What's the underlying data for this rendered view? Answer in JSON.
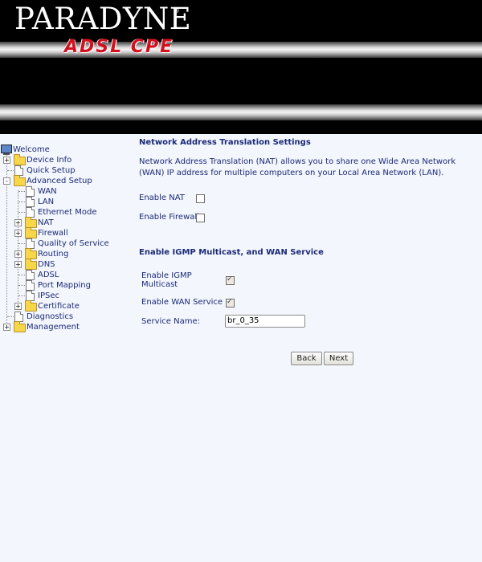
{
  "header": {
    "brand": "PARADYNE",
    "registered": "®",
    "product": "ADSL CPE"
  },
  "sidebar": {
    "items": [
      {
        "label": "Welcome",
        "icon": "monitor-icon"
      },
      {
        "label": "Device Info",
        "icon": "folder-icon",
        "expander": "+"
      },
      {
        "label": "Quick  Setup",
        "icon": "page-icon"
      },
      {
        "label": "Advanced Setup",
        "icon": "folder-open-icon",
        "expander": "-"
      },
      {
        "label": "WAN",
        "icon": "page-icon"
      },
      {
        "label": "LAN",
        "icon": "page-icon"
      },
      {
        "label": "Ethernet Mode",
        "icon": "page-icon"
      },
      {
        "label": "NAT",
        "icon": "folder-icon",
        "expander": "+"
      },
      {
        "label": "Firewall",
        "icon": "folder-icon",
        "expander": "+"
      },
      {
        "label": "Quality of Service",
        "icon": "page-icon"
      },
      {
        "label": "Routing",
        "icon": "folder-icon",
        "expander": "+"
      },
      {
        "label": "DNS",
        "icon": "folder-icon",
        "expander": "+"
      },
      {
        "label": "ADSL",
        "icon": "page-icon"
      },
      {
        "label": "Port Mapping",
        "icon": "page-icon"
      },
      {
        "label": "IPSec",
        "icon": "page-icon"
      },
      {
        "label": "Certificate",
        "icon": "folder-icon",
        "expander": "+"
      },
      {
        "label": "Diagnostics",
        "icon": "page-icon"
      },
      {
        "label": "Management",
        "icon": "folder-icon",
        "expander": "+"
      }
    ]
  },
  "main": {
    "nat_title": "Network Address Translation Settings",
    "nat_desc": "Network Address Translation (NAT) allows you to share one Wide Area Network (WAN) IP address for multiple computers on your Local Area Network (LAN).",
    "enable_nat_label": "Enable NAT",
    "enable_nat_checked": false,
    "enable_firewall_label": "Enable Firewall",
    "enable_firewall_checked": false,
    "igmp_title": "Enable IGMP Multicast, and WAN Service",
    "enable_igmp_label_1": "Enable IGMP",
    "enable_igmp_label_2": "Multicast",
    "enable_igmp_checked": true,
    "enable_wan_label": "Enable WAN Service",
    "enable_wan_checked": true,
    "service_name_label": "Service Name:",
    "service_name_value": "br_0_35",
    "back_label": "Back",
    "next_label": "Next"
  },
  "colors": {
    "text": "#1b2a78",
    "background": "#f3f6fc",
    "header_bg": "#000000",
    "brand_red": "#d2101e"
  }
}
